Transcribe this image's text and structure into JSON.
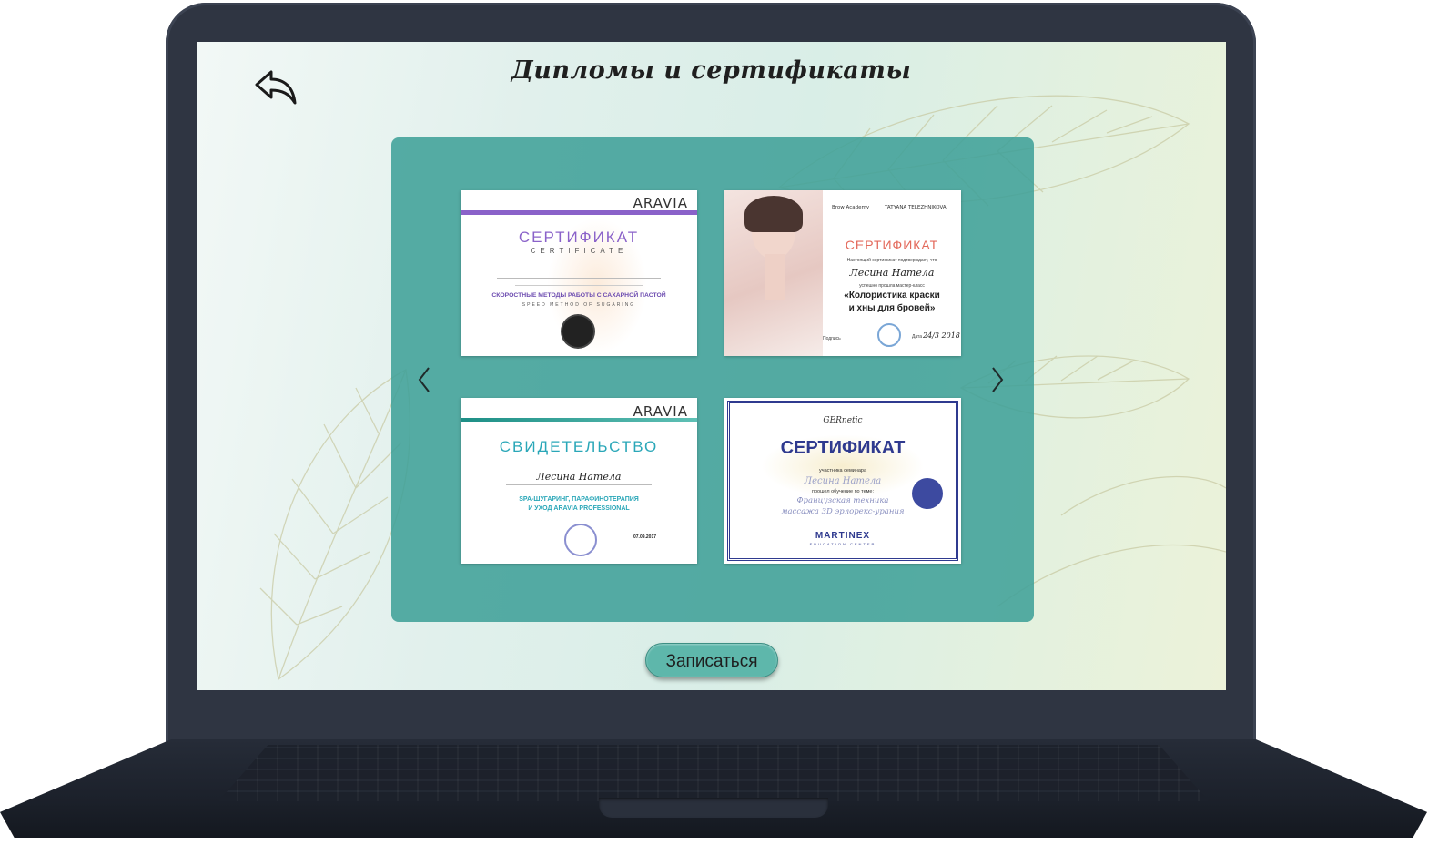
{
  "page": {
    "title": "Дипломы и сертификаты",
    "back_icon": "back-arrow-icon",
    "enroll_label": "Записаться"
  },
  "gallery": {
    "prev_icon": "chevron-left-icon",
    "next_icon": "chevron-right-icon",
    "certificates": [
      {
        "brand": "ARAVIA",
        "heading": "СЕРТИФИКАТ",
        "subheading": "CERTIFICATE",
        "course": "СКОРОСТНЫЕ МЕТОДЫ РАБОТЫ С САХАРНОЙ ПАСТОЙ",
        "course_en": "SPEED METHOD OF SUGARING",
        "accent": "#8a62c9"
      },
      {
        "brand_left": "Brow Academy",
        "brand_right": "TATYANA TELEZHNIKOVA",
        "heading": "СЕРТИФИКАТ",
        "intro": "Настоящий сертификат подтверждает, что",
        "name": "Лесина Натела",
        "passed": "успешно прошла мастер-класс",
        "course_line1": "«Колористика краски",
        "course_line2": "и хны для бровей»",
        "signature_label": "Подпись",
        "date_label": "Дата",
        "date": "24/3 2018",
        "accent": "#e36a5c"
      },
      {
        "brand": "ARAVIA",
        "heading": "СВИДЕТЕЛЬСТВО",
        "name": "Лесина Натела",
        "course_line1": "SPA-ШУГАРИНГ, ПАРАФИНОТЕРАПИЯ",
        "course_line2": "И УХОД ARAVIA PROFESSIONAL",
        "date": "07.09.2017",
        "accent": "#2aa7b8"
      },
      {
        "brand": "GERnetic",
        "heading": "СЕРТИФИКАТ",
        "participant": "участника семинара",
        "name": "Лесина Натела",
        "passed": "прошел обучение по теме:",
        "topic_line1": "Французская техника",
        "topic_line2": "массажа 3D эрлорекс-урания",
        "footer_brand": "MARTINEX",
        "footer_sub": "EDUCATION CENTER",
        "accent": "#2f3a8f"
      }
    ]
  }
}
